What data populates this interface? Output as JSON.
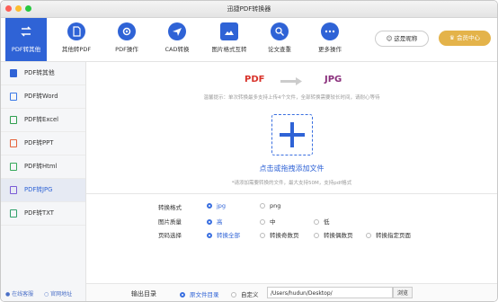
{
  "window": {
    "title": "迅捷PDF转换器"
  },
  "toolbar": {
    "tools": [
      {
        "label": "PDF转其他",
        "icon": "convert-icon"
      },
      {
        "label": "其他转PDF",
        "icon": "pdf-doc-icon"
      },
      {
        "label": "PDF操作",
        "icon": "gear-icon"
      },
      {
        "label": "CAD转换",
        "icon": "send-icon"
      },
      {
        "label": "图片格式互转",
        "icon": "image-icon"
      },
      {
        "label": "论文查重",
        "icon": "search-doc-icon"
      },
      {
        "label": "更多操作",
        "icon": "more-icon"
      }
    ],
    "login_label": "这是昵称",
    "vip_label": "会员中心"
  },
  "sidebar": {
    "items": [
      {
        "label": "PDF转其他",
        "color": "#2f63d6"
      },
      {
        "label": "PDF转Word",
        "color": "#3a78e6"
      },
      {
        "label": "PDF转Excel",
        "color": "#2e9e4f"
      },
      {
        "label": "PDF转PPT",
        "color": "#e5623a"
      },
      {
        "label": "PDF转Html",
        "color": "#36a85a"
      },
      {
        "label": "PDF转JPG",
        "color": "#7a5bd6"
      },
      {
        "label": "PDF转TXT",
        "color": "#2fa06a"
      }
    ],
    "footer_service": "在线客服",
    "footer_site": "官网地址"
  },
  "main": {
    "from_format": "PDF",
    "to_format": "JPG",
    "tip": "温馨提示：单次转换最多支持上传4个文件，全部转换需要较长时间，请耐心等待",
    "drop_label": "点击或拖拽添加文件",
    "drop_sub": "*请添加需要转换的文件，最大支持50M，支持pdf格式"
  },
  "options": {
    "format": {
      "label": "转换格式",
      "choices": [
        "jpg",
        "png"
      ],
      "selected": "jpg"
    },
    "quality": {
      "label": "图片质量",
      "choices": [
        "高",
        "中",
        "低"
      ],
      "selected": "高"
    },
    "pages": {
      "label": "页码选择",
      "choices": [
        "转换全部",
        "转换奇数页",
        "转换偶数页",
        "转换指定页面"
      ],
      "selected": "转换全部"
    }
  },
  "output": {
    "label": "输出目录",
    "original_dir": "原文件目录",
    "custom": "自定义",
    "path": "/Users/hudun/Desktop/",
    "browse": "浏览"
  },
  "colors": {
    "accent": "#2f63d6",
    "pdf_red": "#d8322a",
    "jpg_purple": "#8a2f7c",
    "vip_gold": "#e4b34a"
  }
}
